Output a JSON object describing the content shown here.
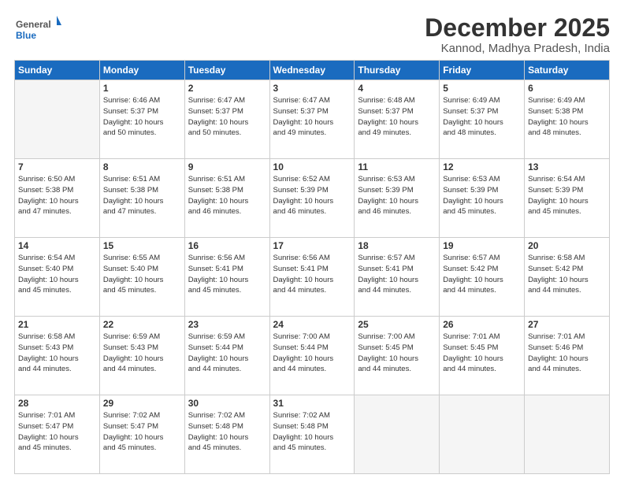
{
  "header": {
    "logo_general": "General",
    "logo_blue": "Blue",
    "month_title": "December 2025",
    "location": "Kannod, Madhya Pradesh, India"
  },
  "weekdays": [
    "Sunday",
    "Monday",
    "Tuesday",
    "Wednesday",
    "Thursday",
    "Friday",
    "Saturday"
  ],
  "weeks": [
    [
      {
        "day": "",
        "info": ""
      },
      {
        "day": "1",
        "info": "Sunrise: 6:46 AM\nSunset: 5:37 PM\nDaylight: 10 hours\nand 50 minutes."
      },
      {
        "day": "2",
        "info": "Sunrise: 6:47 AM\nSunset: 5:37 PM\nDaylight: 10 hours\nand 50 minutes."
      },
      {
        "day": "3",
        "info": "Sunrise: 6:47 AM\nSunset: 5:37 PM\nDaylight: 10 hours\nand 49 minutes."
      },
      {
        "day": "4",
        "info": "Sunrise: 6:48 AM\nSunset: 5:37 PM\nDaylight: 10 hours\nand 49 minutes."
      },
      {
        "day": "5",
        "info": "Sunrise: 6:49 AM\nSunset: 5:37 PM\nDaylight: 10 hours\nand 48 minutes."
      },
      {
        "day": "6",
        "info": "Sunrise: 6:49 AM\nSunset: 5:38 PM\nDaylight: 10 hours\nand 48 minutes."
      }
    ],
    [
      {
        "day": "7",
        "info": "Sunrise: 6:50 AM\nSunset: 5:38 PM\nDaylight: 10 hours\nand 47 minutes."
      },
      {
        "day": "8",
        "info": "Sunrise: 6:51 AM\nSunset: 5:38 PM\nDaylight: 10 hours\nand 47 minutes."
      },
      {
        "day": "9",
        "info": "Sunrise: 6:51 AM\nSunset: 5:38 PM\nDaylight: 10 hours\nand 46 minutes."
      },
      {
        "day": "10",
        "info": "Sunrise: 6:52 AM\nSunset: 5:39 PM\nDaylight: 10 hours\nand 46 minutes."
      },
      {
        "day": "11",
        "info": "Sunrise: 6:53 AM\nSunset: 5:39 PM\nDaylight: 10 hours\nand 46 minutes."
      },
      {
        "day": "12",
        "info": "Sunrise: 6:53 AM\nSunset: 5:39 PM\nDaylight: 10 hours\nand 45 minutes."
      },
      {
        "day": "13",
        "info": "Sunrise: 6:54 AM\nSunset: 5:39 PM\nDaylight: 10 hours\nand 45 minutes."
      }
    ],
    [
      {
        "day": "14",
        "info": "Sunrise: 6:54 AM\nSunset: 5:40 PM\nDaylight: 10 hours\nand 45 minutes."
      },
      {
        "day": "15",
        "info": "Sunrise: 6:55 AM\nSunset: 5:40 PM\nDaylight: 10 hours\nand 45 minutes."
      },
      {
        "day": "16",
        "info": "Sunrise: 6:56 AM\nSunset: 5:41 PM\nDaylight: 10 hours\nand 45 minutes."
      },
      {
        "day": "17",
        "info": "Sunrise: 6:56 AM\nSunset: 5:41 PM\nDaylight: 10 hours\nand 44 minutes."
      },
      {
        "day": "18",
        "info": "Sunrise: 6:57 AM\nSunset: 5:41 PM\nDaylight: 10 hours\nand 44 minutes."
      },
      {
        "day": "19",
        "info": "Sunrise: 6:57 AM\nSunset: 5:42 PM\nDaylight: 10 hours\nand 44 minutes."
      },
      {
        "day": "20",
        "info": "Sunrise: 6:58 AM\nSunset: 5:42 PM\nDaylight: 10 hours\nand 44 minutes."
      }
    ],
    [
      {
        "day": "21",
        "info": "Sunrise: 6:58 AM\nSunset: 5:43 PM\nDaylight: 10 hours\nand 44 minutes."
      },
      {
        "day": "22",
        "info": "Sunrise: 6:59 AM\nSunset: 5:43 PM\nDaylight: 10 hours\nand 44 minutes."
      },
      {
        "day": "23",
        "info": "Sunrise: 6:59 AM\nSunset: 5:44 PM\nDaylight: 10 hours\nand 44 minutes."
      },
      {
        "day": "24",
        "info": "Sunrise: 7:00 AM\nSunset: 5:44 PM\nDaylight: 10 hours\nand 44 minutes."
      },
      {
        "day": "25",
        "info": "Sunrise: 7:00 AM\nSunset: 5:45 PM\nDaylight: 10 hours\nand 44 minutes."
      },
      {
        "day": "26",
        "info": "Sunrise: 7:01 AM\nSunset: 5:45 PM\nDaylight: 10 hours\nand 44 minutes."
      },
      {
        "day": "27",
        "info": "Sunrise: 7:01 AM\nSunset: 5:46 PM\nDaylight: 10 hours\nand 44 minutes."
      }
    ],
    [
      {
        "day": "28",
        "info": "Sunrise: 7:01 AM\nSunset: 5:47 PM\nDaylight: 10 hours\nand 45 minutes."
      },
      {
        "day": "29",
        "info": "Sunrise: 7:02 AM\nSunset: 5:47 PM\nDaylight: 10 hours\nand 45 minutes."
      },
      {
        "day": "30",
        "info": "Sunrise: 7:02 AM\nSunset: 5:48 PM\nDaylight: 10 hours\nand 45 minutes."
      },
      {
        "day": "31",
        "info": "Sunrise: 7:02 AM\nSunset: 5:48 PM\nDaylight: 10 hours\nand 45 minutes."
      },
      {
        "day": "",
        "info": ""
      },
      {
        "day": "",
        "info": ""
      },
      {
        "day": "",
        "info": ""
      }
    ]
  ]
}
